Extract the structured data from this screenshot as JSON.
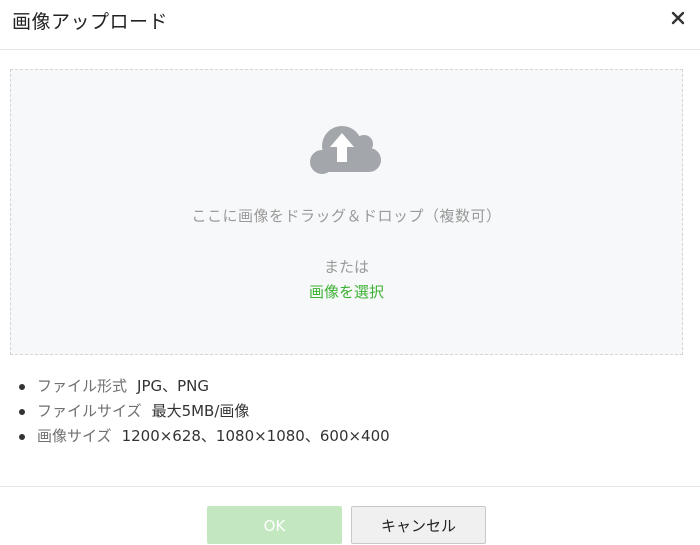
{
  "dialog": {
    "title": "画像アップロード",
    "close_icon": "close-icon"
  },
  "dropzone": {
    "icon": "cloud-upload-icon",
    "drop_text": "ここに画像をドラッグ＆ドロップ（複数可）",
    "or_text": "または",
    "select_link": "画像を選択"
  },
  "specs": [
    {
      "label": "ファイル形式",
      "value": "JPG、PNG"
    },
    {
      "label": "ファイルサイズ",
      "value": "最大5MB/画像"
    },
    {
      "label": "画像サイズ",
      "value": "1200×628、1080×1080、600×400"
    }
  ],
  "footer": {
    "ok_label": "OK",
    "cancel_label": "キャンセル"
  },
  "colors": {
    "accent_green": "#3cb234",
    "ok_disabled": "#c3e8bf",
    "icon_gray": "#a3a6aa"
  }
}
